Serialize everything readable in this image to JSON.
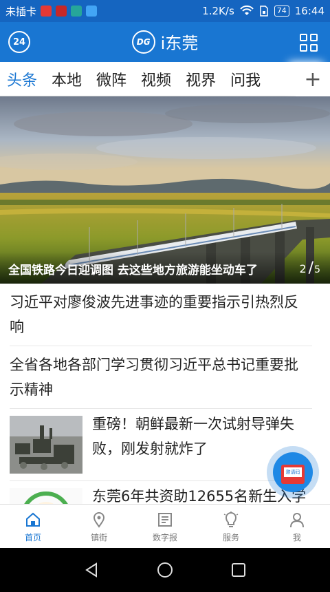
{
  "status_bar": {
    "carrier": "未插卡",
    "speed": "1.2K/s",
    "battery": "74",
    "time": "16:44"
  },
  "app_bar": {
    "left_badge": "24",
    "logo": "DG",
    "title": "i东莞"
  },
  "tabs": [
    {
      "label": "头条",
      "active": true
    },
    {
      "label": "本地"
    },
    {
      "label": "微阵"
    },
    {
      "label": "视频"
    },
    {
      "label": "视界"
    },
    {
      "label": "问我"
    }
  ],
  "tab_add": "+",
  "hero": {
    "caption": "全国铁路今日迎调图 去这些地方旅游能坐动车了",
    "page_current": "2",
    "page_total": "5"
  },
  "news": [
    {
      "title": "习近平对廖俊波先进事迹的重要指示引热烈反响"
    },
    {
      "title": "全省各地各部门学习贯彻习近平总书记重要批示精神"
    },
    {
      "title": "重磅！朝鲜最新一次试射导弹失败，刚发射就炸了"
    },
    {
      "title": "东莞6年共资助12655名新生入学"
    }
  ],
  "fab": {
    "label": "邀请码"
  },
  "bottom_nav": [
    {
      "label": "首页",
      "icon": "home-icon",
      "active": true
    },
    {
      "label": "镇街",
      "icon": "location-pin-icon"
    },
    {
      "label": "数字报",
      "icon": "newspaper-icon"
    },
    {
      "label": "服务",
      "icon": "lightbulb-icon"
    },
    {
      "label": "我",
      "icon": "person-icon"
    }
  ],
  "colors": {
    "brand_blue": "#1976d2",
    "status_blue": "#1565c0",
    "active_tab": "#1976d2",
    "text": "#222222"
  }
}
